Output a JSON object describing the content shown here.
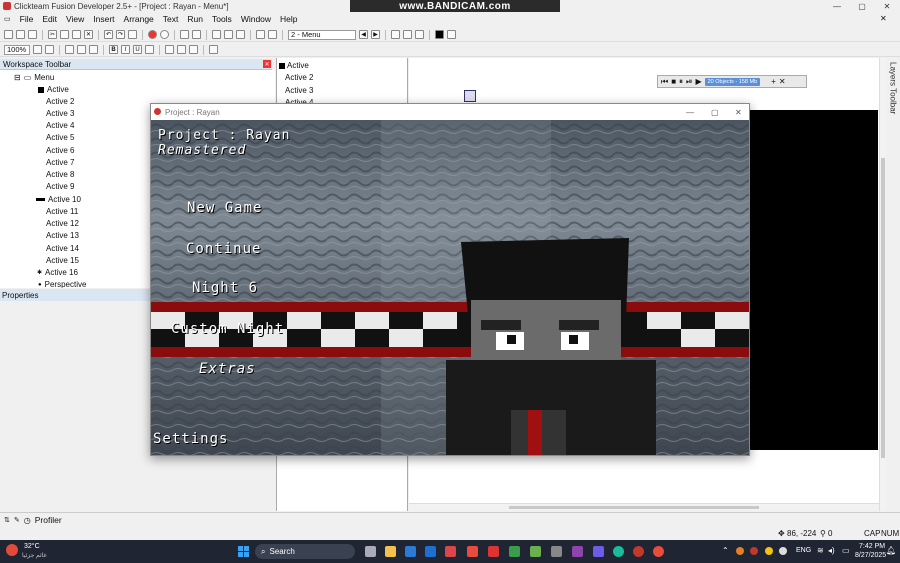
{
  "window": {
    "title": "Clickteam Fusion Developer 2.5+ - [Project : Rayan - Menu*]",
    "recorder_label": "www.BANDICAM.com"
  },
  "menu": [
    "File",
    "Edit",
    "View",
    "Insert",
    "Arrange",
    "Text",
    "Run",
    "Tools",
    "Window",
    "Help"
  ],
  "toolbar": {
    "frame_select": "2 - Menu",
    "zoom_select": "100%"
  },
  "workspace": {
    "header": "Workspace Toolbar",
    "root": "Menu",
    "items": [
      "Active",
      "Active 2",
      "Active 3",
      "Active 4",
      "Active 5",
      "Active 6",
      "Active 7",
      "Active 8",
      "Active 9",
      "Active 10",
      "Active 11",
      "Active 12",
      "Active 13",
      "Active 14",
      "Active 15",
      "Active 16",
      "Perspective"
    ]
  },
  "properties": {
    "header": "Properties"
  },
  "object_list": [
    "Active",
    "Active 2",
    "Active 3",
    "Active 4"
  ],
  "layers_tab": "Layers Toolbar",
  "playbar": {
    "status": "20 Objects - 158 Mb"
  },
  "game_window": {
    "title": "Project : Rayan",
    "game_title_line1": "Project : Rayan",
    "game_title_line2": "Remastered",
    "menu_items": [
      "New Game",
      "Continue",
      "Night 6",
      "Custom Night",
      "Extras",
      "Settings"
    ]
  },
  "bottom_tabs": {
    "profiler": "Profiler"
  },
  "status": {
    "coords": "86, -224",
    "objects": "0",
    "caps": "CAP",
    "num": "NUM"
  },
  "taskbar": {
    "weather_temp": "32°C",
    "weather_desc": "غائم جزئيا",
    "search": "Search",
    "lang": "ENG",
    "time": "7:42 PM",
    "date": "8/27/2025"
  }
}
